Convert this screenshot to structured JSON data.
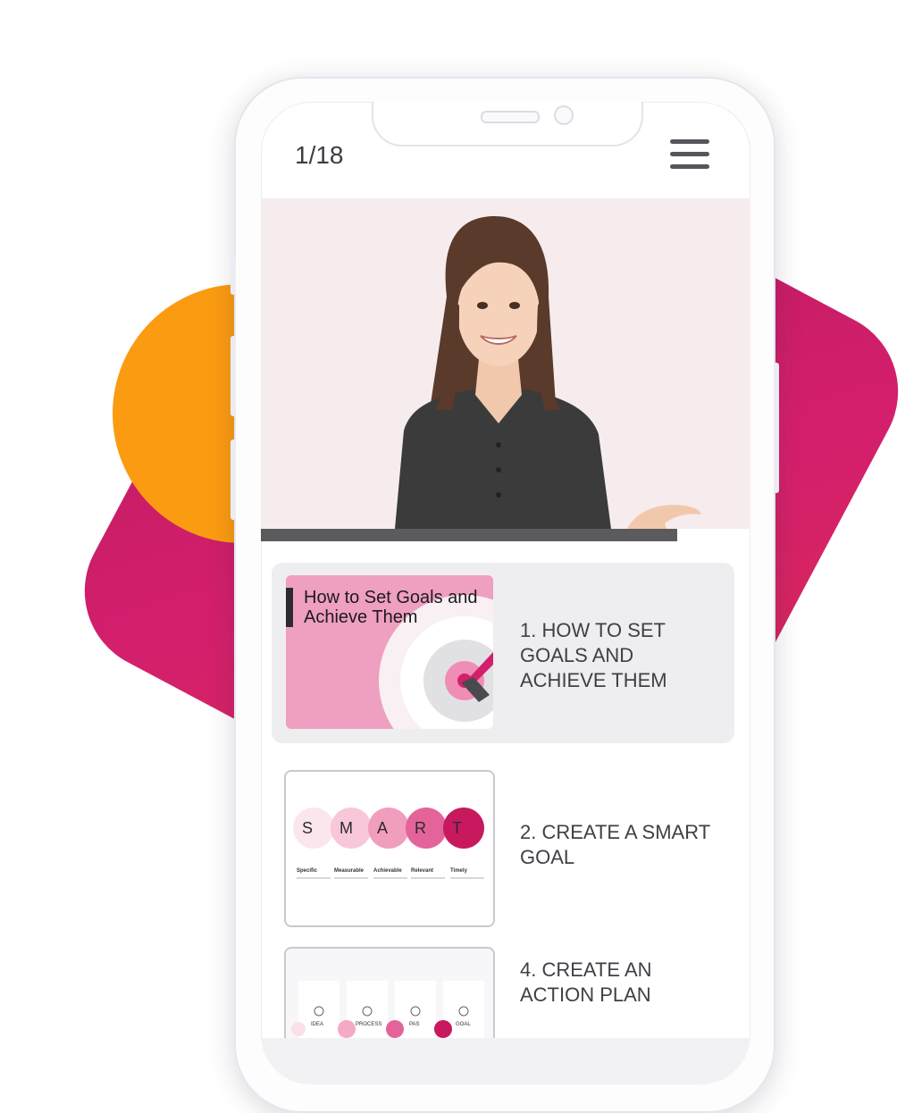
{
  "header": {
    "counter": "1/18",
    "menu_icon": "hamburger-menu-icon"
  },
  "video": {
    "progress": 0.85
  },
  "colors": {
    "accent_pink": "#d41f6d",
    "accent_orange": "#fb9b12",
    "thumb_pink": "#ef9fbf"
  },
  "lessons": [
    {
      "title": "1. How to set goals and achieve them",
      "thumb_text": "How to Set Goals and Achieve Them",
      "active": true
    },
    {
      "title": "2. Create a SMART goal",
      "letters": [
        "S",
        "M",
        "A",
        "R",
        "T"
      ],
      "labels": [
        "Specific",
        "Measurable",
        "Achievable",
        "Relevant",
        "Timely"
      ],
      "active": false
    },
    {
      "title": "4. Create an action plan",
      "steps": [
        "IDEA",
        "PROCESS",
        "PAS",
        "GOAL"
      ],
      "active": false
    }
  ]
}
